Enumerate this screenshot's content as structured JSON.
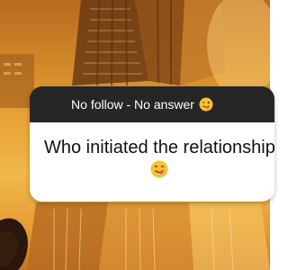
{
  "story": {
    "background": {
      "icon": "city-skyline-illustration",
      "palette": [
        "#b86a1e",
        "#e9a43a",
        "#f0b84c",
        "#7a3f12"
      ]
    },
    "question_sticker": {
      "header": {
        "label": "No follow - No answer",
        "emoji": "winking-face-with-tongue"
      },
      "question": {
        "text": "Who initiated the relationship?",
        "emoji": "face-savoring-food"
      }
    }
  }
}
